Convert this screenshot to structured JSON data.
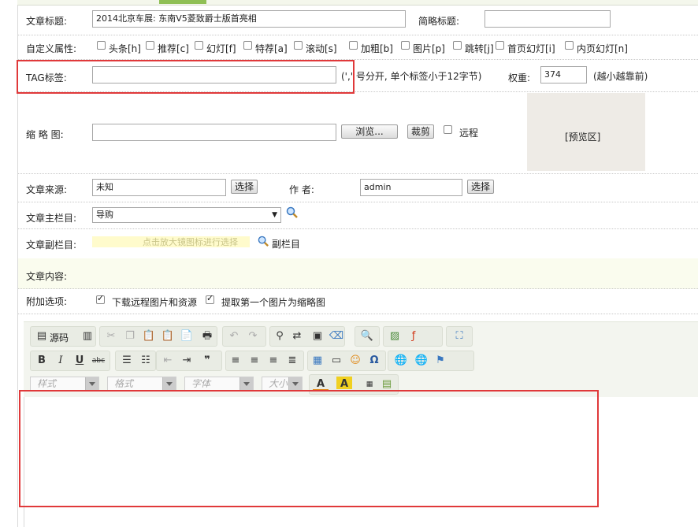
{
  "form": {
    "title_label": "文章标题:",
    "title_value": "2014北京车展: 东南V5菱致爵士版首亮相",
    "short_title_label": "简略标题:",
    "short_title_value": "",
    "attr_label": "自定义属性:",
    "attrs": [
      "头条[h]",
      "推荐[c]",
      "幻灯[f]",
      "特荐[a]",
      "滚动[s]",
      "加粗[b]",
      "图片[p]",
      "跳转[j]",
      "首页幻灯[i]",
      "内页幻灯[n]"
    ],
    "tag_label": "TAG标签:",
    "tag_value": "",
    "tag_hint": "(',' 号分开, 单个标签小于12字节)",
    "weight_label": "权重:",
    "weight_value": "374",
    "weight_hint": "(越小越靠前)",
    "thumb_label": "缩 略 图:",
    "thumb_value": "",
    "browse_label": "浏览...",
    "crop_label": "裁剪",
    "remote_label": "远程",
    "preview_label": "[预览区]",
    "source_label": "文章来源:",
    "source_value": "未知",
    "select_label": "选择",
    "author_label": "作 者:",
    "author_value": "admin",
    "main_col_label": "文章主栏目:",
    "main_col_value": "导购",
    "sub_col_label": "文章副栏目:",
    "sub_col_hint": "点击放大镜图标进行选择",
    "sub_col_link": "副栏目",
    "content_label": "文章内容:",
    "extra_label": "附加选项:",
    "extra_opts": [
      "下载远程图片和资源",
      "提取第一个图片为缩略图"
    ]
  },
  "editor": {
    "source_label": "源码",
    "style_label": "样式",
    "format_label": "格式",
    "font_label": "字体",
    "size_label": "大小",
    "bold": "B",
    "italic": "I",
    "underline": "U",
    "strike": "abc"
  },
  "colors": {
    "highlight": "#e0393a",
    "hint_bg": "#fffbcc",
    "content_bg": "#fafcee"
  }
}
